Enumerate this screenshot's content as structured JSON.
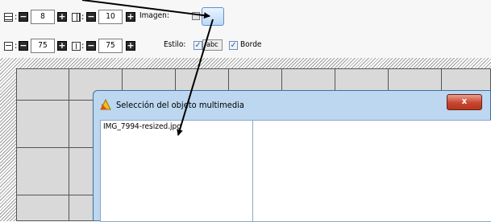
{
  "toolbar": {
    "rows_value": "8",
    "cols_value": "10",
    "width_value": "75",
    "height_value": "75",
    "image_label": "Imagen:",
    "style_label": "Estilo:",
    "abc_text": "abc",
    "border_label": "Borde",
    "minus": "−",
    "plus": "+",
    "colon": ":",
    "check_mark": "✓"
  },
  "dialog": {
    "title": "Selección del objeto multimedia",
    "close_symbol": "x",
    "files": [
      "IMG_7994-resized.jpg"
    ]
  },
  "colors": {
    "arrow": "#000000",
    "close_button": "#c8452f",
    "dialog_frame": "#bcd7ef"
  },
  "icons": [
    "rows-icon",
    "columns-icon",
    "width-icon",
    "height-icon",
    "multimedia-icon",
    "arrow-annotation"
  ]
}
